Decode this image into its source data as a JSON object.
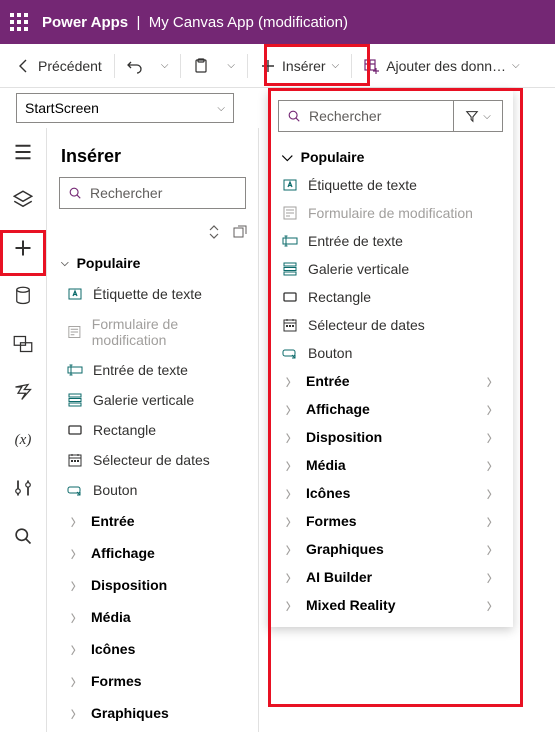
{
  "header": {
    "brand": "Power Apps",
    "sep": "|",
    "app": "My Canvas App (modification)"
  },
  "toolbar": {
    "back": "Précédent",
    "insert": "Insérer",
    "addData": "Ajouter des donn…"
  },
  "screenSelect": {
    "value": "StartScreen"
  },
  "panel": {
    "title": "Insérer",
    "searchPlaceholder": "Rechercher",
    "popularHead": "Populaire",
    "items": [
      {
        "label": "Étiquette de texte",
        "icon": "label-icon",
        "disabled": false
      },
      {
        "label": "Formulaire de modification",
        "icon": "form-icon",
        "disabled": true
      },
      {
        "label": "Entrée de texte",
        "icon": "textinput-icon",
        "disabled": false
      },
      {
        "label": "Galerie verticale",
        "icon": "gallery-icon",
        "disabled": false
      },
      {
        "label": "Rectangle",
        "icon": "rect-icon",
        "disabled": false
      },
      {
        "label": "Sélecteur de dates",
        "icon": "date-icon",
        "disabled": false
      },
      {
        "label": "Bouton",
        "icon": "button-icon",
        "disabled": false
      }
    ],
    "categories": [
      "Entrée",
      "Affichage",
      "Disposition",
      "Média",
      "Icônes",
      "Formes",
      "Graphiques"
    ]
  },
  "flyout": {
    "searchPlaceholder": "Rechercher",
    "popularHead": "Populaire",
    "items": [
      {
        "label": "Étiquette de texte",
        "icon": "label-icon",
        "disabled": false
      },
      {
        "label": "Formulaire de modification",
        "icon": "form-icon",
        "disabled": true
      },
      {
        "label": "Entrée de texte",
        "icon": "textinput-icon",
        "disabled": false
      },
      {
        "label": "Galerie verticale",
        "icon": "gallery-icon",
        "disabled": false
      },
      {
        "label": "Rectangle",
        "icon": "rect-icon",
        "disabled": false
      },
      {
        "label": "Sélecteur de dates",
        "icon": "date-icon",
        "disabled": false
      },
      {
        "label": "Bouton",
        "icon": "button-icon",
        "disabled": false
      }
    ],
    "categories": [
      "Entrée",
      "Affichage",
      "Disposition",
      "Média",
      "Icônes",
      "Formes",
      "Graphiques",
      "AI Builder",
      "Mixed Reality"
    ]
  }
}
